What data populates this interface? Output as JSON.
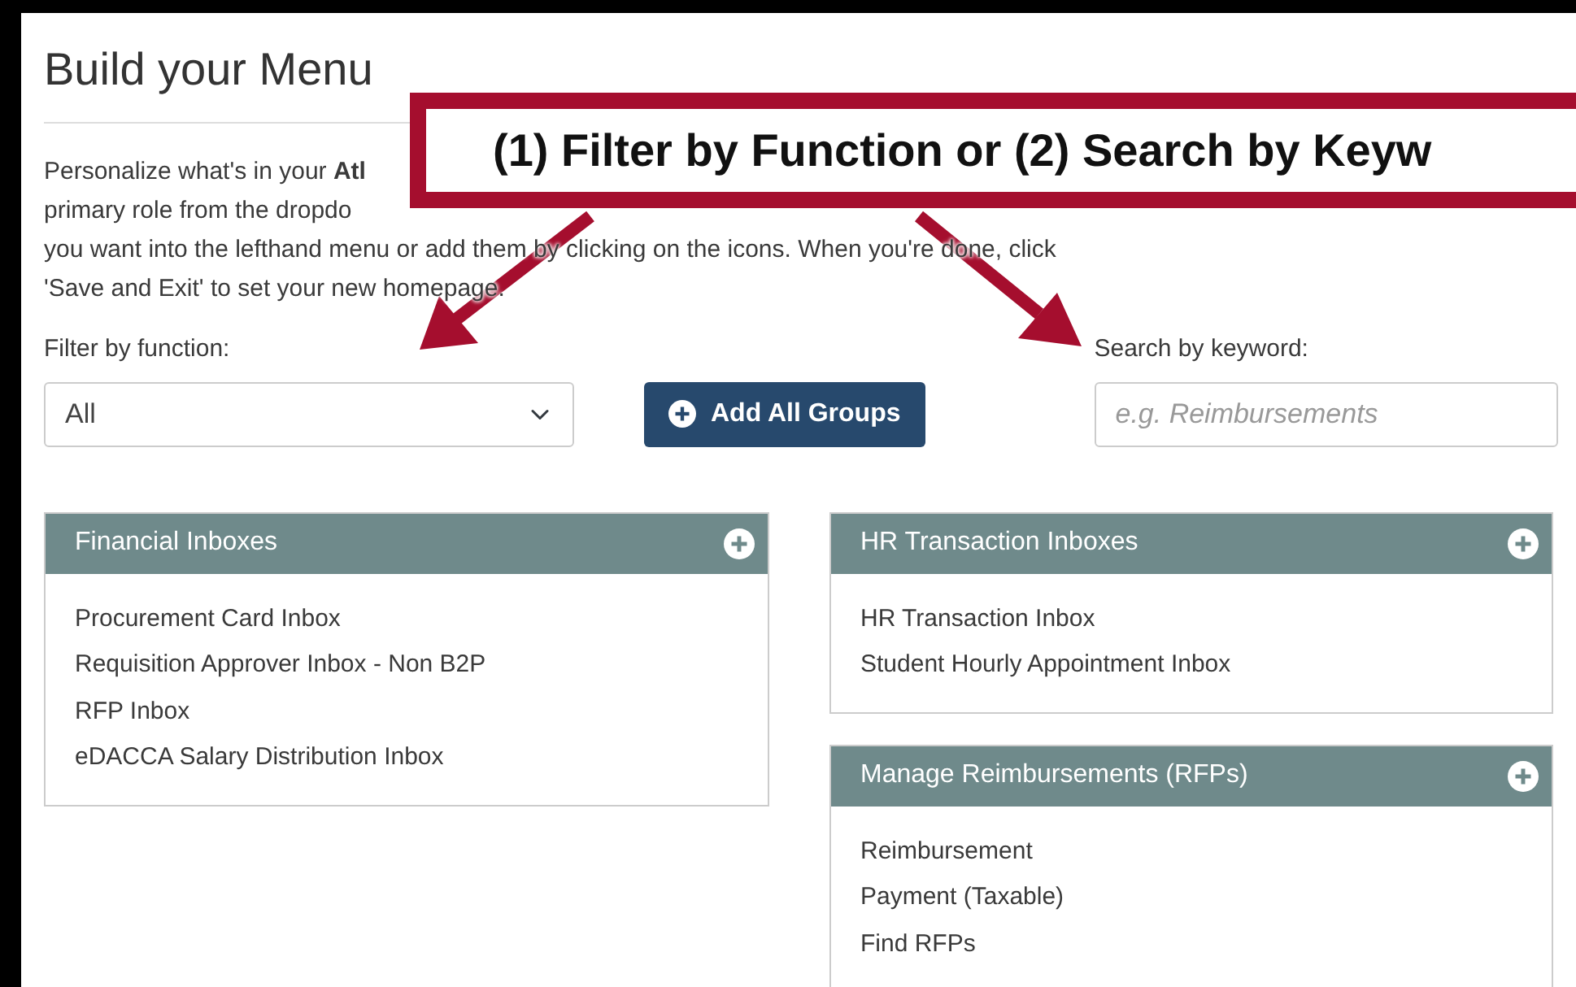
{
  "title": "Build your Menu",
  "intro_lines": [
    "Personalize what's in your **Atl**",
    "primary role from the dropdo",
    "you want into the lefthand menu or add them by clicking on the  icons. When you're done, click",
    "'Save and Exit' to set your new homepage."
  ],
  "callout": {
    "text": "(1) Filter by Function or (2) Search by Keyw"
  },
  "filter": {
    "label": "Filter by function:",
    "value": "All"
  },
  "add_button": {
    "label": "Add All Groups"
  },
  "search": {
    "label": "Search by keyword:",
    "placeholder": "e.g. Reimbursements"
  },
  "columns": [
    {
      "panels": [
        {
          "title": "Financial Inboxes",
          "items": [
            "Procurement Card Inbox",
            "Requisition Approver Inbox - Non B2P",
            "RFP Inbox",
            "eDACCA Salary Distribution Inbox"
          ]
        }
      ]
    },
    {
      "panels": [
        {
          "title": "HR Transaction Inboxes",
          "items": [
            "HR Transaction Inbox",
            "Student Hourly Appointment Inbox"
          ]
        },
        {
          "title": "Manage Reimbursements (RFPs)",
          "items": [
            "Reimbursement",
            "Payment (Taxable)",
            "Find RFPs"
          ]
        }
      ]
    }
  ]
}
